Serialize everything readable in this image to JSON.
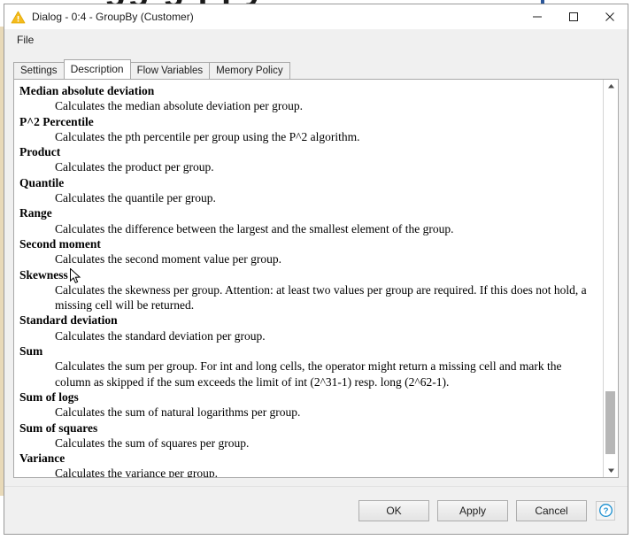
{
  "window": {
    "title": "Dialog - 0:4 - GroupBy (Customer)",
    "icon": "warning-triangle-icon",
    "minimize_label": "—",
    "maximize_label": "□",
    "close_label": "✕"
  },
  "menubar": {
    "items": [
      {
        "label": "File"
      }
    ]
  },
  "tabs": [
    {
      "label": "Settings",
      "active": false
    },
    {
      "label": "Description",
      "active": true
    },
    {
      "label": "Flow Variables",
      "active": false
    },
    {
      "label": "Memory Policy",
      "active": false
    }
  ],
  "description": {
    "entries": [
      {
        "term": "Median absolute deviation",
        "definition": "Calculates the median absolute deviation per group."
      },
      {
        "term": "P^2 Percentile",
        "definition": "Calculates the pth percentile per group using the P^2 algorithm."
      },
      {
        "term": "Product",
        "definition": "Calculates the product per group."
      },
      {
        "term": "Quantile",
        "definition": "Calculates the quantile per group."
      },
      {
        "term": "Range",
        "definition": "Calculates the difference between the largest and the smallest element of the group."
      },
      {
        "term": "Second moment",
        "definition": "Calculates the second moment value per group."
      },
      {
        "term": "Skewness",
        "definition": "Calculates the skewness per group. Attention: at least two values per group are required. If this does not hold, a missing cell will be returned."
      },
      {
        "term": "Standard deviation",
        "definition": "Calculates the standard deviation per group."
      },
      {
        "term": "Sum",
        "definition": "Calculates the sum per group. For int and long cells, the operator might return a missing cell and mark the column as skipped if the sum exceeds the limit of int (2^31-1) resp. long (2^62-1)."
      },
      {
        "term": "Sum of logs",
        "definition": "Calculates the sum of natural logarithms per group."
      },
      {
        "term": "Sum of squares",
        "definition": "Calculates the sum of squares per group."
      },
      {
        "term": "Variance",
        "definition": "Calculates the variance per group."
      }
    ]
  },
  "scrollbar": {
    "up_arrow": "chevron-up-icon",
    "down_arrow": "chevron-down-icon",
    "thumb_top_pct": 80.5,
    "thumb_height_pct": 17.0
  },
  "buttons": {
    "ok": "OK",
    "apply": "Apply",
    "cancel": "Cancel",
    "help": "?"
  },
  "colors": {
    "accent_blue": "#2a5699",
    "help_blue": "#1a8fd0",
    "warning_yellow": "#f5bb1d",
    "dialog_face": "#f0f0f0",
    "content_bg": "#ffffff",
    "scroll_thumb": "#b6b6b6"
  }
}
